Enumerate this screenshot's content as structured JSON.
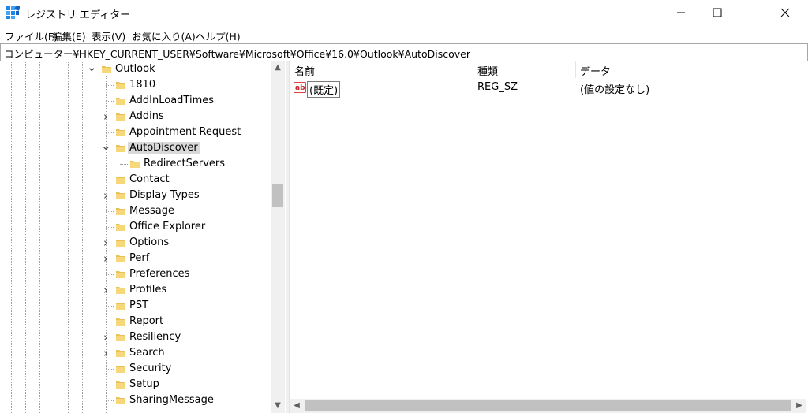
{
  "window": {
    "title": "レジストリ エディター",
    "icon": "registry-editor-icon",
    "controls": [
      "minimize-icon",
      "maximize-icon",
      "close-icon"
    ]
  },
  "menu": [
    {
      "label": "ファイル(F)"
    },
    {
      "label": "編集(E)"
    },
    {
      "label": "表示(V)"
    },
    {
      "label": "お気に入り(A)"
    },
    {
      "label": "ヘルプ(H)"
    }
  ],
  "address": "コンピューター¥HKEY_CURRENT_USER¥Software¥Microsoft¥Office¥16.0¥Outlook¥AutoDiscover",
  "tree": [
    {
      "label": "Outlook",
      "expander": "expanded",
      "level": 0
    },
    {
      "label": "1810",
      "expander": "none",
      "level": 1
    },
    {
      "label": "AddInLoadTimes",
      "expander": "none",
      "level": 1
    },
    {
      "label": "Addins",
      "expander": "collapsed",
      "level": 1
    },
    {
      "label": "Appointment Request",
      "expander": "none",
      "level": 1
    },
    {
      "label": "AutoDiscover",
      "expander": "expanded",
      "level": 1,
      "selected": true
    },
    {
      "label": "RedirectServers",
      "expander": "none",
      "level": 2
    },
    {
      "label": "Contact",
      "expander": "none",
      "level": 1
    },
    {
      "label": "Display Types",
      "expander": "collapsed",
      "level": 1
    },
    {
      "label": "Message",
      "expander": "none",
      "level": 1
    },
    {
      "label": "Office Explorer",
      "expander": "none",
      "level": 1
    },
    {
      "label": "Options",
      "expander": "collapsed",
      "level": 1
    },
    {
      "label": "Perf",
      "expander": "collapsed",
      "level": 1
    },
    {
      "label": "Preferences",
      "expander": "none",
      "level": 1
    },
    {
      "label": "Profiles",
      "expander": "collapsed",
      "level": 1
    },
    {
      "label": "PST",
      "expander": "none",
      "level": 1
    },
    {
      "label": "Report",
      "expander": "none",
      "level": 1
    },
    {
      "label": "Resiliency",
      "expander": "collapsed",
      "level": 1
    },
    {
      "label": "Search",
      "expander": "collapsed",
      "level": 1
    },
    {
      "label": "Security",
      "expander": "none",
      "level": 1
    },
    {
      "label": "Setup",
      "expander": "none",
      "level": 1
    },
    {
      "label": "SharingMessage",
      "expander": "none",
      "level": 1
    }
  ],
  "list": {
    "headers": {
      "name": "名前",
      "type": "種類",
      "data": "データ"
    },
    "rows": [
      {
        "icon": "string-value-icon",
        "name": "(既定)",
        "type": "REG_SZ",
        "data": "(値の設定なし)"
      }
    ]
  },
  "colors": {
    "selection": "#d9d9d9",
    "folder": "#e8c15a",
    "scrollbar": "#c1c1c1"
  }
}
